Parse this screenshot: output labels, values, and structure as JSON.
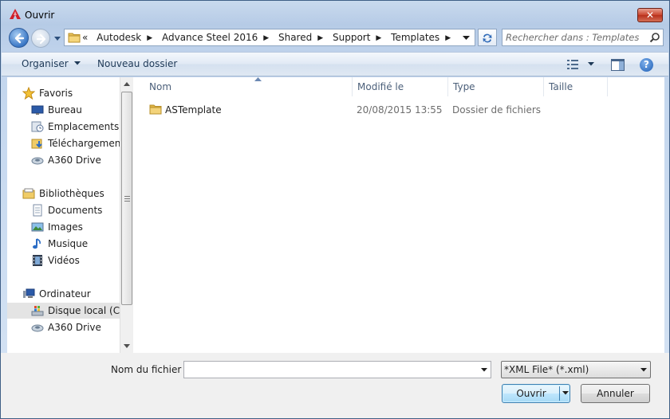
{
  "window": {
    "title": "Ouvrir",
    "close_label": "✕"
  },
  "address_bar": {
    "overflow_marker": "«",
    "breadcrumbs": [
      "Autodesk",
      "Advance Steel 2016",
      "Shared",
      "Support",
      "Templates"
    ]
  },
  "search": {
    "placeholder": "Rechercher dans : Templates"
  },
  "toolbar": {
    "organize_label": "Organiser",
    "new_folder_label": "Nouveau dossier",
    "help_label": "?"
  },
  "nav_pane": {
    "items": [
      {
        "label": "Favoris",
        "icon": "star-icon",
        "indent": 0
      },
      {
        "label": "Bureau",
        "icon": "desktop-icon",
        "indent": 1
      },
      {
        "label": "Emplacements ré",
        "icon": "recent-places-icon",
        "indent": 1
      },
      {
        "label": "Téléchargements",
        "icon": "downloads-icon",
        "indent": 1
      },
      {
        "label": "A360 Drive",
        "icon": "cloud-drive-icon",
        "indent": 1
      },
      {
        "label": "Bibliothèques",
        "icon": "libraries-icon",
        "indent": 0
      },
      {
        "label": "Documents",
        "icon": "documents-icon",
        "indent": 1
      },
      {
        "label": "Images",
        "icon": "pictures-icon",
        "indent": 1
      },
      {
        "label": "Musique",
        "icon": "music-icon",
        "indent": 1
      },
      {
        "label": "Vidéos",
        "icon": "videos-icon",
        "indent": 1
      },
      {
        "label": "Ordinateur",
        "icon": "computer-icon",
        "indent": 0
      },
      {
        "label": "Disque local (C:)",
        "icon": "local-disk-icon",
        "indent": 1,
        "selected": true
      },
      {
        "label": "A360 Drive",
        "icon": "cloud-drive-icon",
        "indent": 1
      }
    ]
  },
  "file_list": {
    "columns": [
      "Nom",
      "Modifié le",
      "Type",
      "Taille"
    ],
    "rows": [
      {
        "name": "ASTemplate",
        "modified": "20/08/2015 13:55",
        "type": "Dossier de fichiers",
        "size": ""
      }
    ]
  },
  "footer": {
    "filename_label": "Nom du fichier :",
    "filename_value": "",
    "filetype_value": "*XML File* (*.xml)",
    "open_label": "Ouvrir",
    "cancel_label": "Annuler"
  }
}
